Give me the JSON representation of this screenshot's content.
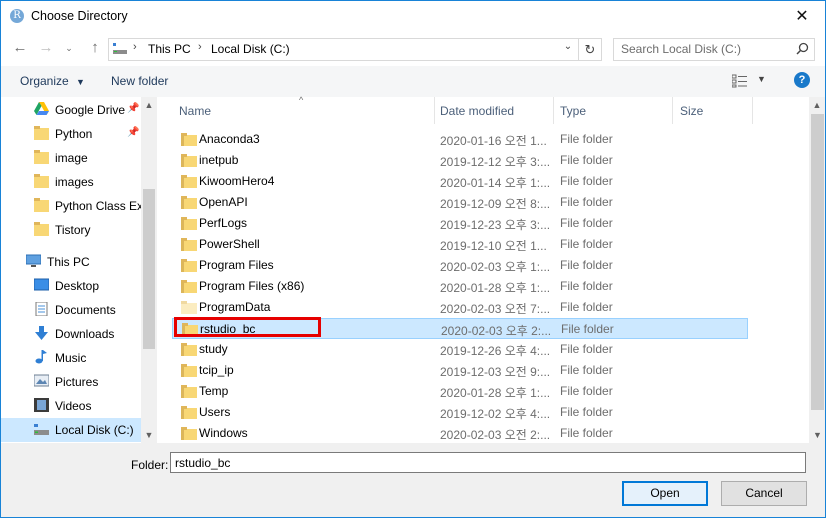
{
  "window": {
    "title": "Choose Directory",
    "app_icon_letter": "R"
  },
  "address": {
    "crumbs": [
      "This PC",
      "Local Disk (C:)"
    ]
  },
  "search": {
    "placeholder": "Search Local Disk (C:)"
  },
  "toolbar": {
    "organize": "Organize",
    "new_folder": "New folder",
    "help": "?"
  },
  "nav": {
    "quick_access": [
      "Google Drive",
      "Python",
      "image",
      "images",
      "Python Class Exe",
      "Tistory"
    ],
    "this_pc": "This PC",
    "pc_items": [
      "Desktop",
      "Documents",
      "Downloads",
      "Music",
      "Pictures",
      "Videos",
      "Local Disk (C:)"
    ]
  },
  "columns": {
    "name": "Name",
    "date": "Date modified",
    "type": "Type",
    "size": "Size"
  },
  "files": [
    {
      "name": "Anaconda3",
      "date": "2020-01-16 오전 1...",
      "type": "File folder"
    },
    {
      "name": "inetpub",
      "date": "2019-12-12 오후 3:...",
      "type": "File folder"
    },
    {
      "name": "KiwoomHero4",
      "date": "2020-01-14 오후 1:...",
      "type": "File folder"
    },
    {
      "name": "OpenAPI",
      "date": "2019-12-09 오전 8:...",
      "type": "File folder"
    },
    {
      "name": "PerfLogs",
      "date": "2019-12-23 오후 3:...",
      "type": "File folder"
    },
    {
      "name": "PowerShell",
      "date": "2019-12-10 오전 1...",
      "type": "File folder"
    },
    {
      "name": "Program Files",
      "date": "2020-02-03 오후 1:...",
      "type": "File folder"
    },
    {
      "name": "Program Files (x86)",
      "date": "2020-01-28 오후 1:...",
      "type": "File folder"
    },
    {
      "name": "ProgramData",
      "date": "2020-02-03 오전 7:...",
      "type": "File folder"
    },
    {
      "name": "rstudio_bc",
      "date": "2020-02-03 오후 2:...",
      "type": "File folder"
    },
    {
      "name": "study",
      "date": "2019-12-26 오후 4:...",
      "type": "File folder"
    },
    {
      "name": "tcip_ip",
      "date": "2019-12-03 오전 9:...",
      "type": "File folder"
    },
    {
      "name": "Temp",
      "date": "2020-01-28 오후 1:...",
      "type": "File folder"
    },
    {
      "name": "Users",
      "date": "2019-12-02 오후 4:...",
      "type": "File folder"
    },
    {
      "name": "Windows",
      "date": "2020-02-03 오전 2:...",
      "type": "File folder"
    }
  ],
  "footer": {
    "folder_label": "Folder:",
    "folder_value": "rstudio_bc",
    "open": "Open",
    "cancel": "Cancel"
  },
  "colors": {
    "accent": "#0078d7",
    "selection": "#cce8ff",
    "folder": "#dcb65a",
    "highlight_box": "#e60000"
  }
}
